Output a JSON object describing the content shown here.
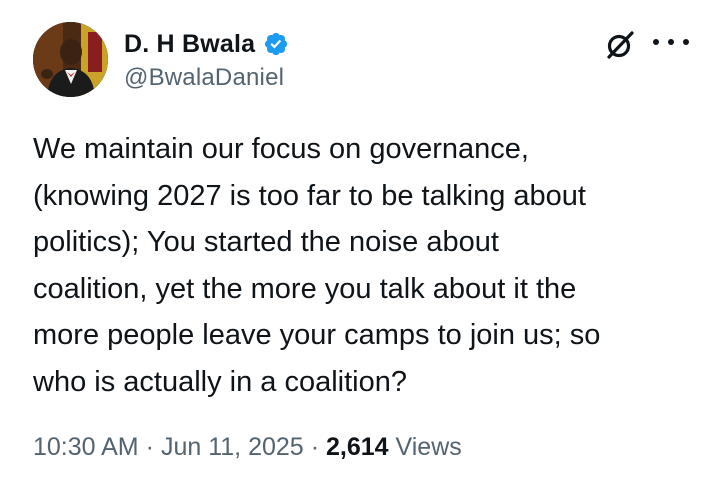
{
  "author": {
    "display_name": "D. H Bwala",
    "handle": "@BwalaDaniel",
    "verified": true
  },
  "tweet": {
    "lines": [
      "We maintain our focus on governance,",
      "(knowing 2027 is too far to be talking about",
      "politics); You started the noise about",
      "coalition, yet the more you talk about it the",
      "more people leave your camps to join us; so",
      "who is actually in a coalition?"
    ]
  },
  "meta": {
    "time": "10:30 AM",
    "separator": "·",
    "date": "Jun 11, 2025",
    "views_count": "2,614",
    "views_label": "Views"
  },
  "icons": {
    "verified": "verified-badge-icon",
    "grok": "grok-icon",
    "more": "more-options-icon"
  },
  "colors": {
    "verified_blue": "#1d9bf0",
    "text_primary": "#0f1419",
    "text_secondary": "#536471"
  }
}
